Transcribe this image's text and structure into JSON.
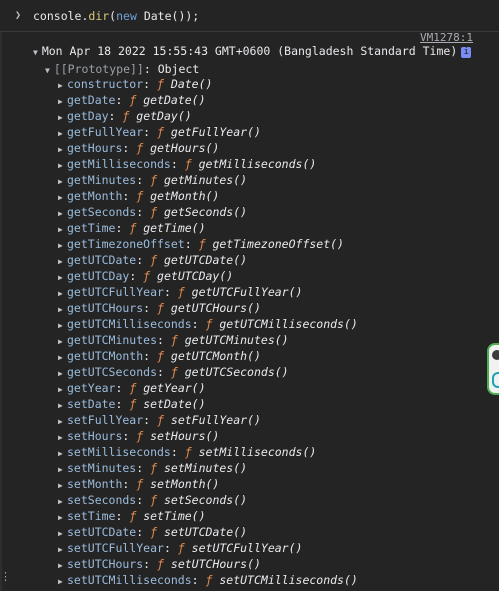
{
  "input": {
    "prompt": ">",
    "code_prefix": "console.",
    "method": "dir",
    "open_paren": "(",
    "keyword_new": "new",
    "space": " ",
    "class_name": "Date",
    "close": "());"
  },
  "source_link": "VM1278:1",
  "summary": "Mon Apr 18 2022 15:55:43 GMT+0600 (Bangladesh Standard Time)",
  "info_badge": "i",
  "prototype": {
    "label": "[[Prototype]]",
    "separator": ": ",
    "value": "Object"
  },
  "function_symbol": "ƒ",
  "methods": [
    "constructor:Date",
    "getDate:getDate",
    "getDay:getDay",
    "getFullYear:getFullYear",
    "getHours:getHours",
    "getMilliseconds:getMilliseconds",
    "getMinutes:getMinutes",
    "getMonth:getMonth",
    "getSeconds:getSeconds",
    "getTime:getTime",
    "getTimezoneOffset:getTimezoneOffset",
    "getUTCDate:getUTCDate",
    "getUTCDay:getUTCDay",
    "getUTCFullYear:getUTCFullYear",
    "getUTCHours:getUTCHours",
    "getUTCMilliseconds:getUTCMilliseconds",
    "getUTCMinutes:getUTCMinutes",
    "getUTCMonth:getUTCMonth",
    "getUTCSeconds:getUTCSeconds",
    "getYear:getYear",
    "setDate:setDate",
    "setFullYear:setFullYear",
    "setHours:setHours",
    "setMilliseconds:setMilliseconds",
    "setMinutes:setMinutes",
    "setMonth:setMonth",
    "setSeconds:setSeconds",
    "setTime:setTime",
    "setUTCDate:setUTCDate",
    "setUTCFullYear:setUTCFullYear",
    "setUTCHours:setUTCHours",
    "setUTCMilliseconds:setUTCMilliseconds"
  ],
  "colors": {
    "background": "#242424",
    "keyword": "#6f9fd8",
    "method": "#d9c97c",
    "property_key": "#9bbbdc",
    "function_symbol": "#e78a4e",
    "badge": "#7a8cf5",
    "side_widget_border": "#4caf50"
  },
  "icons": {
    "prompt": "chevron-right-icon",
    "expand": "triangle-down-icon",
    "collapsed": "triangle-right-icon",
    "info": "info-icon"
  }
}
